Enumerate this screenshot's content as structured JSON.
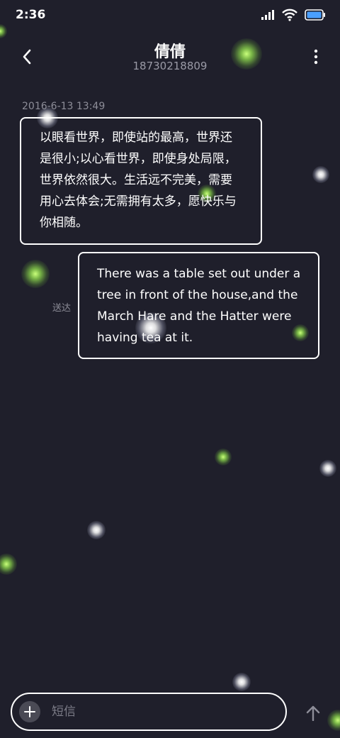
{
  "status_bar": {
    "time": "2:36"
  },
  "header": {
    "contact_name": "倩倩",
    "contact_number": "18730218809"
  },
  "conversation": {
    "timestamp": "2016-6-13 13:49",
    "incoming_message": "以眼看世界，即使站的最高，世界还是很小;以心看世界，即使身处局限，世界依然很大。生活远不完美，需要用心去体会;无需拥有太多，愿快乐与你相随。",
    "outgoing_message": "There was a table set out under a tree in front of the house,and the March Hare and the Hatter were having tea at it.",
    "delivery_status": "送达"
  },
  "compose": {
    "placeholder": "短信"
  },
  "icons": {
    "back": "chevron-left-icon",
    "more": "more-vertical-icon",
    "attach": "plus-icon",
    "send": "arrow-up-icon",
    "signal": "signal-icon",
    "wifi": "wifi-icon",
    "battery": "battery-icon"
  },
  "colors": {
    "background": "#1f1f2b",
    "text": "#ffffff",
    "muted": "#8d8d98",
    "battery_accent": "#4a9fff",
    "glow_green": "#b4ff6a",
    "glow_white": "#ffffff"
  }
}
